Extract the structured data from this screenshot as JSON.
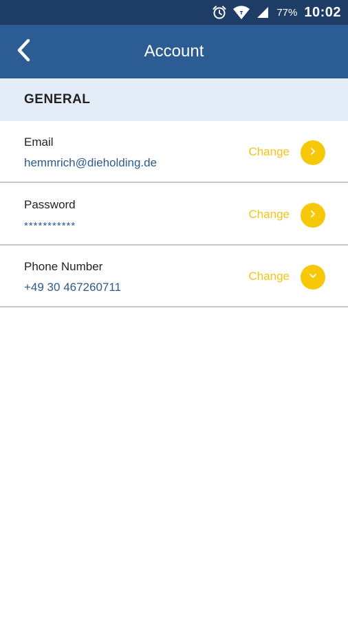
{
  "status_bar": {
    "battery": "77%",
    "time": "10:02"
  },
  "app_bar": {
    "title": "Account"
  },
  "section": {
    "title": "GENERAL"
  },
  "rows": [
    {
      "label": "Email",
      "value": "hemmrich@dieholding.de",
      "action": "Change",
      "icon": "chevron-right-icon"
    },
    {
      "label": "Password",
      "value": "***********",
      "action": "Change",
      "icon": "chevron-right-icon"
    },
    {
      "label": "Phone Number",
      "value": "+49 30 467260711",
      "action": "Change",
      "icon": "chevron-down-icon"
    }
  ],
  "colors": {
    "status_bar": "#1e3d66",
    "app_bar": "#2b5c93",
    "section_bg": "#e3edf8",
    "accent": "#f7c808",
    "value_text": "#2c5a8c"
  }
}
